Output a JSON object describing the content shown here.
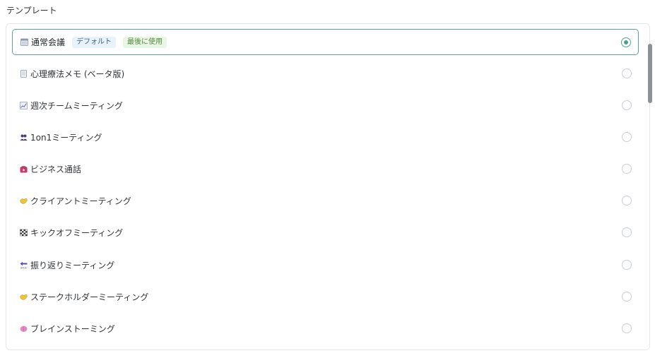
{
  "section": {
    "title": "テンプレート"
  },
  "badges": {
    "default": "デフォルト",
    "recent": "最後に使用"
  },
  "templates": [
    {
      "label": "通常会議",
      "icon": "calendar-icon",
      "selected": true
    },
    {
      "label": "心理療法メモ (ベータ版)",
      "icon": "memo-icon",
      "selected": false
    },
    {
      "label": "週次チームミーティング",
      "icon": "chart-icon",
      "selected": false
    },
    {
      "label": "1on1ミーティング",
      "icon": "people-icon",
      "selected": false
    },
    {
      "label": "ビジネス通話",
      "icon": "telephone-icon",
      "selected": false
    },
    {
      "label": "クライアントミーティング",
      "icon": "handshake-icon",
      "selected": false
    },
    {
      "label": "キックオフミーティング",
      "icon": "checkered-flag-icon",
      "selected": false
    },
    {
      "label": "振り返りミーティング",
      "icon": "back-arrow-icon",
      "selected": false
    },
    {
      "label": "ステークホルダーミーティング",
      "icon": "handshake-icon",
      "selected": false
    },
    {
      "label": "ブレインストーミング",
      "icon": "brain-icon",
      "selected": false
    }
  ]
}
